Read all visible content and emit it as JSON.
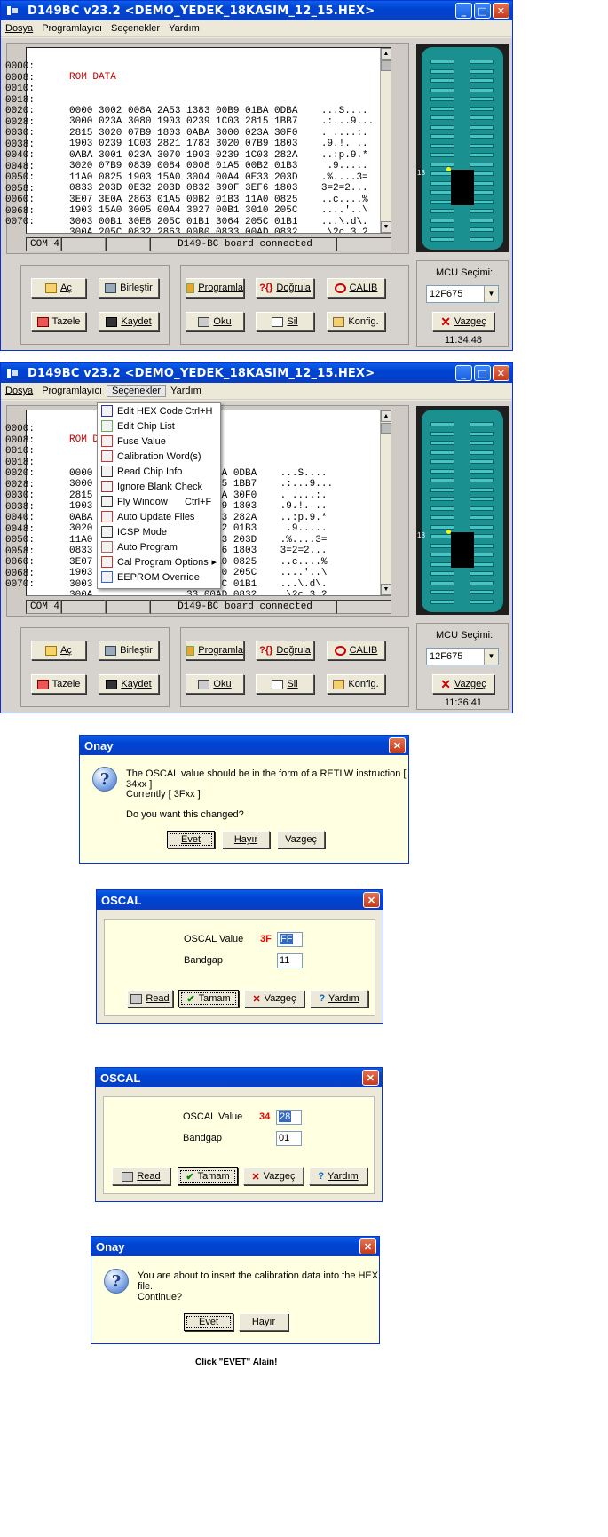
{
  "win1": {
    "title": "D149BC  v23.2   <DEMO_YEDEK_18KASIM_12_15.HEX>",
    "menu": [
      "Dosya",
      "Programlayıcı",
      "Seçenekler",
      "Yardım"
    ],
    "hex_header": "ROM DATA",
    "hex_rows": [
      {
        "addr": "0000:",
        "data": "0000 3002 008A 2A53 1383 00B9 01BA 0DBA    ...S...."
      },
      {
        "addr": "0008:",
        "data": "3000 023A 3080 1903 0239 1C03 2815 1BB7    .:...9..."
      },
      {
        "addr": "0010:",
        "data": "2815 3020 07B9 1803 0ABA 3000 023A 30F0    . ....:."
      },
      {
        "addr": "0018:",
        "data": "1903 0239 1C03 2821 1783 3020 07B9 1803    .9.!. .."
      },
      {
        "addr": "0020:",
        "data": "0ABA 3001 023A 3070 1903 0239 1C03 282A    ..:p.9.*"
      },
      {
        "addr": "0028:",
        "data": "3020 07B9 0839 0084 0008 01A5 00B2 01B3     .9....."
      },
      {
        "addr": "0030:",
        "data": "11A0 0825 1903 15A0 3004 00A4 0E33 203D    .%....3="
      },
      {
        "addr": "0038:",
        "data": "0833 203D 0E32 203D 0832 390F 3EF6 1803    3=2=2..."
      },
      {
        "addr": "0040:",
        "data": "3E07 3E0A 2863 01A5 00B2 01B3 11A0 0825    ..c....%"
      },
      {
        "addr": "0048:",
        "data": "1903 15A0 3005 00A4 3027 00B1 3010 205C    ....'..\\"
      },
      {
        "addr": "0050:",
        "data": "3003 00B1 30E8 205C 01B1 3064 205C 01B1    ...\\.d\\."
      },
      {
        "addr": "0058:",
        "data": "300A 205C 0832 2863 00B0 0833 00AD 0832    .\\2c.3.2"
      },
      {
        "addr": "0060:",
        "data": "00AC 21D7 082C 00AC 03A4 1903 11A0 0825    ..,....%"
      },
      {
        "addr": "0068:",
        "data": "1903 286D 0224 1803 2874 082C 1D03 11A0    .m$.t,.."
      },
      {
        "addr": "0070:",
        "data": "19A0 2874 3E30 2930 0008 00B7 1089 1109    .t00...."
      }
    ],
    "status": {
      "port": "COM 4",
      "message": "D149-BC board connected"
    },
    "buttons": {
      "open": "Aç",
      "merge": "Birleştir",
      "refresh": "Tazele",
      "save": "Kaydet",
      "program": "Programla",
      "verify": "Doğrula",
      "calib": "CALIB",
      "read": "Oku",
      "erase": "Sil",
      "config": "Konfig."
    },
    "mcu_label": "MCU Seçimi:",
    "mcu_value": "12F675",
    "cancel": "Vazgeç",
    "time": "11:34:48",
    "ic_label": "18"
  },
  "win2": {
    "title": "D149BC  v23.2   <DEMO_YEDEK_18KASIM_12_15.HEX>",
    "time": "11:36:41",
    "hex_rows_left": [
      "0000",
      "3000",
      "2815",
      "1903",
      "0ABA",
      "3020",
      "11A0",
      "0833",
      "3E07",
      "1903",
      "3003",
      "300A",
      "00AC",
      "1903",
      "19A0"
    ],
    "hex_rows_right": [
      "39 01BA 0DBA    ...S....",
      "03 2815 1BB7    .:...9...",
      "20 023A 30F0    . ....:.",
      "20 07B9 1803    .9.!. ..",
      "39 1C03 282A    ..:p.9.*",
      "A5 00B2 01B3     .9.....",
      "A4 0E33 203D    .%....3=",
      "0F 3EF6 1803    3=2=2...",
      "33 11A0 0825    ..c....%",
      "B1 3010 205C    ....'..\\",
      "54 205C 01B1    ...\\.d\\.",
      "33 00AD 0832    .\\2c.3.2",
      "03 11A0 0825    ..,....%",
      "2C 1D03 11A0    .m$.t,..",
      "B7 1089 1109    .t00...."
    ],
    "menu_items": [
      {
        "label": "Edit HEX Code",
        "shortcut": "Ctrl+H",
        "icon": "edit-hex-icon"
      },
      {
        "label": "Edit Chip List",
        "shortcut": "",
        "icon": "chip-list-icon"
      },
      {
        "label": "Fuse Value",
        "shortcut": "",
        "icon": "fuse-icon"
      },
      {
        "label": "Calibration Word(s)",
        "shortcut": "",
        "icon": "calibration-icon"
      },
      {
        "label": "Read Chip Info",
        "shortcut": "",
        "icon": "read-chip-icon"
      },
      {
        "label": "Ignore Blank Check",
        "shortcut": "",
        "icon": "ignore-blank-icon"
      },
      {
        "label": "Fly Window",
        "shortcut": "Ctrl+F",
        "icon": "fly-window-icon"
      },
      {
        "label": "Auto Update Files",
        "shortcut": "",
        "icon": "auto-update-icon"
      },
      {
        "label": "ICSP Mode",
        "shortcut": "",
        "icon": "icsp-icon"
      },
      {
        "label": "Auto Program",
        "shortcut": "",
        "icon": "auto-program-icon"
      },
      {
        "label": "Cal Program Options",
        "shortcut": "",
        "icon": "cal-options-icon"
      },
      {
        "label": "EEPROM Override",
        "shortcut": "",
        "icon": "eeprom-icon"
      }
    ]
  },
  "dlg1": {
    "title": "Onay",
    "line1": "The OSCAL value should be in the form of a RETLW instruction [ 34xx ]",
    "line2": "Currently [ 3Fxx ]",
    "line3": "Do you want this changed?",
    "yes": "Evet",
    "no": "Hayır",
    "cancel": "Vazgeç"
  },
  "dlg2": {
    "title": "OSCAL",
    "oscal_label": "OSCAL Value",
    "prefix": "3F",
    "value": "FF",
    "bandgap_label": "Bandgap",
    "bandgap": "11",
    "read": "Read",
    "ok": "Tamam",
    "cancel": "Vazgeç",
    "help": "Yardım"
  },
  "dlg3": {
    "title": "OSCAL",
    "oscal_label": "OSCAL Value",
    "prefix": "34",
    "value": "28",
    "bandgap_label": "Bandgap",
    "bandgap": "01",
    "read": "Read",
    "ok": "Tamam",
    "cancel": "Vazgeç",
    "help": "Yardım"
  },
  "dlg4": {
    "title": "Onay",
    "line1": "You are about to insert the calibration data into the HEX file.",
    "line2": "Continue?",
    "yes": "Evet",
    "no": "Hayır"
  },
  "caption": "Click \"EVET\" Alain!"
}
